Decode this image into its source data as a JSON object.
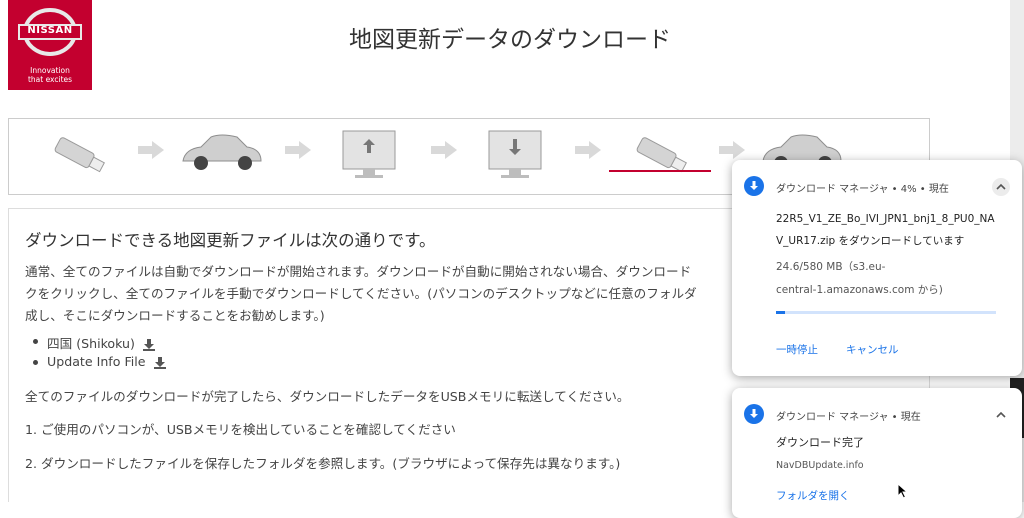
{
  "brand": {
    "logo_text": "NISSAN",
    "tagline_line1": "Innovation",
    "tagline_line2": "that excites",
    "color": "#c3002f"
  },
  "page_title": "地図更新データのダウンロード",
  "steps": {
    "items": [
      "usb-stick-icon",
      "car-icon",
      "pc-upload-icon",
      "pc-download-icon",
      "usb-stick-icon",
      "car-icon"
    ],
    "active_index": 4
  },
  "content": {
    "heading": "ダウンロードできる地図更新ファイルは次の通りです。",
    "intro_line1": "通常、全てのファイルは自動でダウンロードが開始されます。ダウンロードが自動に開始されない場合、ダウンロード",
    "intro_line2": "クをクリックし、全てのファイルを手動でダウンロードしてください。(パソコンのデスクトップなどに任意のフォルダ",
    "intro_line3": "成し、そこにダウンロードすることをお勧めします。)",
    "files": [
      "四国 (Shikoku)",
      "Update Info File"
    ],
    "after_download": "全てのファイルのダウンロードが完了したら、ダウンロードしたデータをUSBメモリに転送してください。",
    "step1": "1. ご使用のパソコンが、USBメモリを検出していることを確認してください",
    "step2": "2. ダウンロードしたファイルを保存したフォルダを参照します。(ブラウザによって保存先は異なります。)"
  },
  "download_manager_1": {
    "header": "ダウンロード マネージャ • 4% • 現在",
    "filename_line1": "22R5_V1_ZE_Bo_IVI_JPN1_bnj1_8_PU0_NA",
    "filename_line2": "V_UR17.zip をダウンロードしています",
    "size_line": "24.6/580 MB（s3.eu-",
    "source_line": "central-1.amazonaws.com から)",
    "progress": 0.04,
    "pause_label": "一時停止",
    "cancel_label": "キャンセル"
  },
  "download_manager_2": {
    "header": "ダウンロード マネージャ • 現在",
    "status": "ダウンロード完了",
    "filename": "NavDBUpdate.info",
    "open_folder_label": "フォルダを開く"
  }
}
